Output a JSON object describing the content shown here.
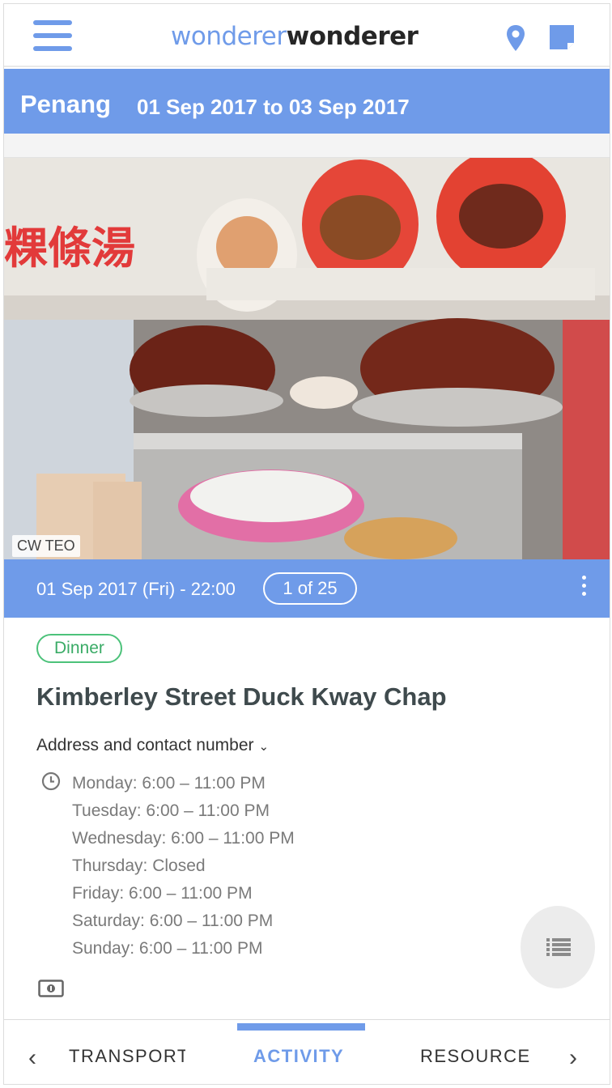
{
  "header": {
    "logo_part1": "wonderer",
    "logo_part2": "wonderer",
    "menu_icon": "hamburger-icon",
    "map_icon": "map-pin-icon",
    "notes_icon": "notes-icon"
  },
  "trip": {
    "city": "Penang",
    "dates": "01 Sep 2017 to 03 Sep 2017"
  },
  "photo": {
    "credit": "CW TEO"
  },
  "activity": {
    "datetime": "01 Sep 2017 (Fri) - 22:00",
    "counter": "1 of 25",
    "tag": "Dinner",
    "name": "Kimberley Street Duck Kway Chap",
    "address_toggle": "Address and contact number",
    "hours": [
      "Monday: 6:00 – 11:00 PM",
      "Tuesday: 6:00 – 11:00 PM",
      "Wednesday: 6:00 – 11:00 PM",
      "Thursday: Closed",
      "Friday: 6:00 – 11:00 PM",
      "Saturday: 6:00 – 11:00 PM",
      "Sunday: 6:00 – 11:00 PM"
    ]
  },
  "tabs": {
    "transport": "TRANSPORT",
    "activity": "ACTIVITY",
    "resource": "RESOURCE",
    "active": "activity"
  },
  "colors": {
    "accent": "#6f9be9",
    "tag_green": "#4cc27a",
    "title": "#3f4a4d"
  }
}
